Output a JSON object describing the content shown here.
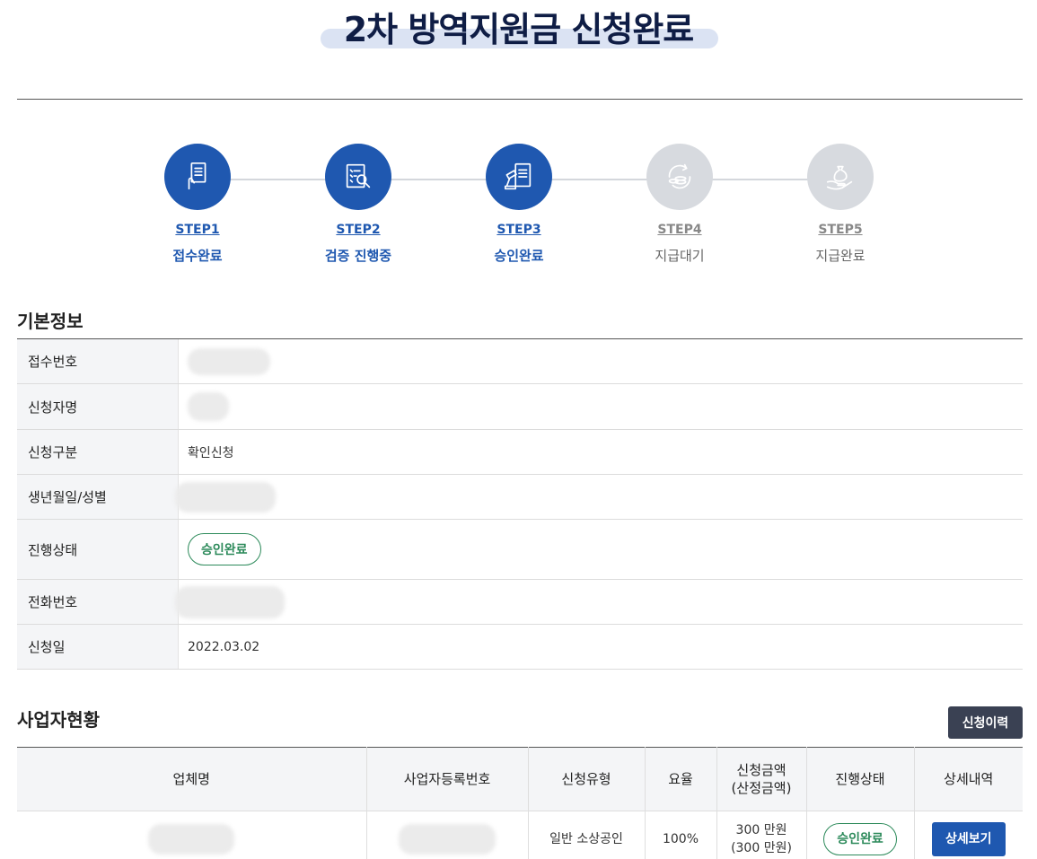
{
  "header": {
    "title": "2차 방역지원금 신청완료"
  },
  "steps": [
    {
      "num": "STEP1",
      "label": "접수완료",
      "status": "active",
      "icon": "document-hand-icon"
    },
    {
      "num": "STEP2",
      "label": "검증 진행중",
      "status": "active",
      "icon": "document-search-icon"
    },
    {
      "num": "STEP3",
      "label": "승인완료",
      "status": "active",
      "icon": "gavel-document-icon"
    },
    {
      "num": "STEP4",
      "label": "지급대기",
      "status": "inactive",
      "icon": "coins-cycle-icon"
    },
    {
      "num": "STEP5",
      "label": "지급완료",
      "status": "inactive",
      "icon": "money-bag-hand-icon"
    }
  ],
  "basic_info": {
    "title": "기본정보",
    "rows": [
      {
        "label": "접수번호",
        "value": ""
      },
      {
        "label": "신청자명",
        "value": ""
      },
      {
        "label": "신청구분",
        "value": "확인신청"
      },
      {
        "label": "생년월일/성별",
        "value": ""
      },
      {
        "label": "진행상태",
        "value": "승인완료"
      },
      {
        "label": "전화번호",
        "value": ""
      },
      {
        "label": "신청일",
        "value": "2022.03.02"
      }
    ]
  },
  "business": {
    "title": "사업자현황",
    "history_button": "신청이력",
    "columns": [
      "업체명",
      "사업자등록번호",
      "신청유형",
      "요율",
      "신청금액",
      "(산정금액)",
      "진행상태",
      "상세내역"
    ],
    "row": {
      "company": "",
      "reg_no": "",
      "type": "일반 소상공인",
      "rate": "100%",
      "amount": "300 만원",
      "amount_calc": "(300 만원)",
      "status": "승인완료",
      "detail_button": "상세보기"
    }
  },
  "colors": {
    "primary": "#1f58b0",
    "inactive": "#d7dadf",
    "success": "#2c8a5a",
    "dark_button": "#3a4153"
  }
}
